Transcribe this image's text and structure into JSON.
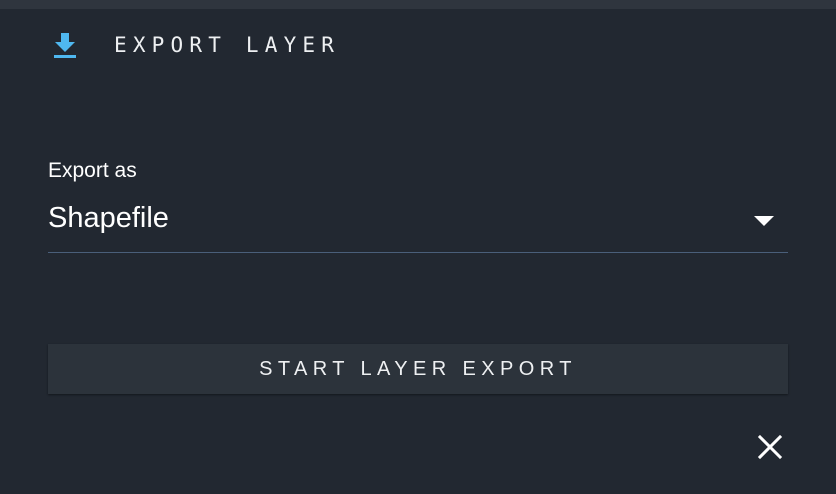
{
  "header": {
    "title": "EXPORT LAYER",
    "icon": "download-icon",
    "icon_color": "#4fb8f0"
  },
  "export_field": {
    "label": "Export as",
    "selected_value": "Shapefile",
    "dropdown_icon": "caret-down-icon"
  },
  "actions": {
    "start_export_label": "START LAYER EXPORT",
    "close_icon": "close-icon"
  },
  "colors": {
    "background": "#222831",
    "top_bar": "#2f353e",
    "button_background": "#2c333b",
    "underline": "#4a5f7a",
    "text": "#eef0f2",
    "accent": "#4fb8f0"
  }
}
